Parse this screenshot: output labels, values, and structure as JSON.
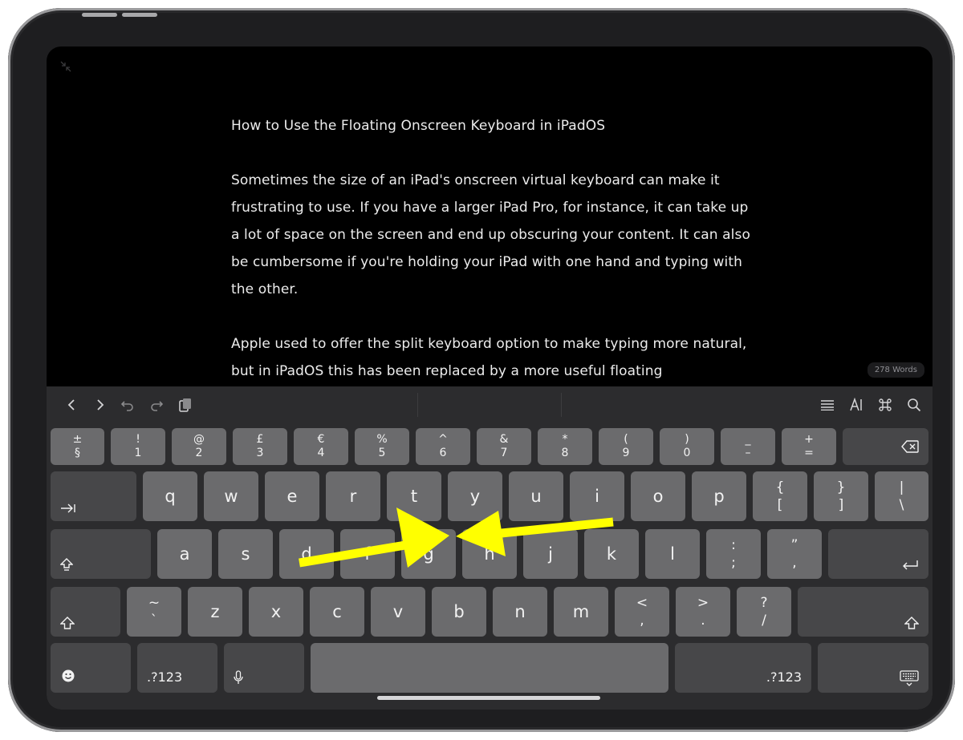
{
  "document": {
    "title": "How to Use the Floating Onscreen Keyboard in iPadOS",
    "paragraphs": [
      "Sometimes the size of an iPad's onscreen virtual keyboard can make it frustrating to use. If you have a larger iPad Pro, for instance, it can take up a lot of space on the screen and end up obscuring your content. It can also be cumbersome if you're holding your iPad with one hand and typing with the other.",
      "Apple used to offer the split keyboard option to make typing more natural, but in iPadOS this has been replaced by a more useful floating"
    ],
    "word_count": "278 Words"
  },
  "toolbar": {
    "left_icons": [
      "chevron-left-icon",
      "chevron-right-icon",
      "undo-icon",
      "redo-icon",
      "paste-icon"
    ],
    "right_icons": [
      "list-icon",
      "text-format-icon",
      "command-icon",
      "search-icon"
    ]
  },
  "keyboard": {
    "number_row": [
      {
        "top": "±",
        "bottom": "§"
      },
      {
        "top": "!",
        "bottom": "1"
      },
      {
        "top": "@",
        "bottom": "2"
      },
      {
        "top": "£",
        "bottom": "3"
      },
      {
        "top": "€",
        "bottom": "4"
      },
      {
        "top": "%",
        "bottom": "5"
      },
      {
        "top": "^",
        "bottom": "6"
      },
      {
        "top": "&",
        "bottom": "7"
      },
      {
        "top": "*",
        "bottom": "8"
      },
      {
        "top": "(",
        "bottom": "9"
      },
      {
        "top": ")",
        "bottom": "0"
      },
      {
        "top": "_",
        "bottom": "–"
      },
      {
        "top": "+",
        "bottom": "="
      }
    ],
    "top_row": [
      "q",
      "w",
      "e",
      "r",
      "t",
      "y",
      "u",
      "i",
      "o",
      "p"
    ],
    "top_row_symbols": [
      {
        "top": "{",
        "bottom": "["
      },
      {
        "top": "}",
        "bottom": "]"
      },
      {
        "top": "|",
        "bottom": "\\"
      }
    ],
    "home_row": [
      "a",
      "s",
      "d",
      "f",
      "g",
      "h",
      "j",
      "k",
      "l"
    ],
    "home_row_symbols": [
      {
        "top": ":",
        "bottom": ";"
      },
      {
        "top": "”",
        "bottom": ","
      }
    ],
    "bottom_row_first": {
      "top": "~",
      "bottom": "`"
    },
    "bottom_row": [
      "z",
      "x",
      "c",
      "v",
      "b",
      "n",
      "m"
    ],
    "bottom_row_symbols": [
      {
        "top": "<",
        "bottom": ","
      },
      {
        "top": ">",
        "bottom": "."
      },
      {
        "top": "?",
        "bottom": "/"
      }
    ],
    "numbers_label": ".?123",
    "numbers_label_right": ".?123",
    "icons": {
      "delete": "delete-icon",
      "tab": "tab-icon",
      "caps": "caps-lock-icon",
      "return": "return-icon",
      "shift": "shift-icon",
      "emoji": "emoji-icon",
      "mic": "microphone-icon",
      "hide": "keyboard-hide-icon"
    }
  },
  "annotation": {
    "arrow_color": "#ffff00"
  }
}
